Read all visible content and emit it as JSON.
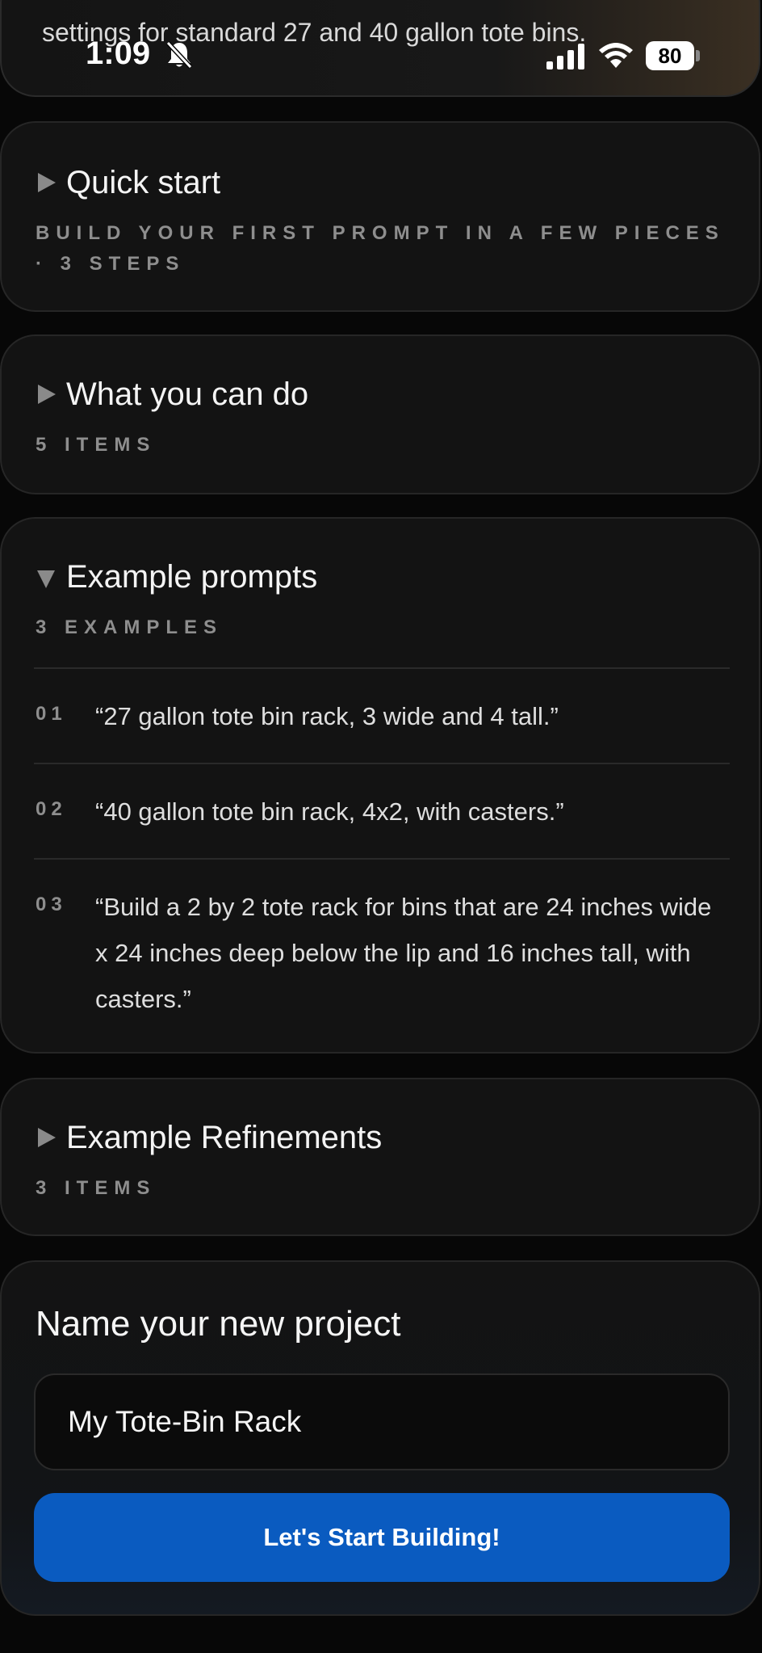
{
  "top_card": {
    "peek_text": "settings for standard 27 and 40 gallon tote bins."
  },
  "status_bar": {
    "time": "1:09",
    "battery": "80",
    "silent_icon": "bell-slash-icon",
    "signal_icon": "cellular-signal-icon",
    "wifi_icon": "wifi-icon"
  },
  "sections": {
    "quick_start": {
      "title": "Quick start",
      "subtitle": "BUILD YOUR FIRST PROMPT IN A FEW PIECES · 3 STEPS",
      "expanded": false
    },
    "what_you_can_do": {
      "title": "What you can do",
      "subtitle": "5 ITEMS",
      "expanded": false
    },
    "example_prompts": {
      "title": "Example prompts",
      "subtitle": "3 EXAMPLES",
      "expanded": true,
      "items": [
        {
          "num": "01",
          "text": "“27 gallon tote bin rack, 3 wide and 4 tall.”"
        },
        {
          "num": "02",
          "text": "“40 gallon tote bin rack, 4x2, with casters.”"
        },
        {
          "num": "03",
          "text": "“Build a 2 by 2 tote rack for bins that are 24 inches wide x 24 inches deep below the lip and 16 inches tall, with casters.”"
        }
      ]
    },
    "example_refinements": {
      "title": "Example Refinements",
      "subtitle": "3 ITEMS",
      "expanded": false
    }
  },
  "new_project": {
    "title": "Name your new project",
    "input_value": "My Tote-Bin Rack",
    "button_label": "Let's Start Building!"
  },
  "colors": {
    "background": "#070707",
    "card": "#131313",
    "accent_button": "#0a5bc0",
    "muted_text": "#8e8e8e"
  }
}
